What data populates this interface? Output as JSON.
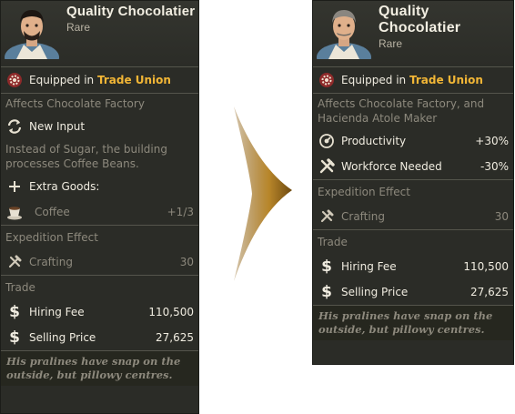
{
  "left_card": {
    "name": "Quality Chocolatier",
    "rarity": "Rare",
    "equipped_prefix": "Equipped in",
    "equipped_building": "Trade Union",
    "affects": "Affects Chocolate Factory",
    "effect_label": "New Input",
    "effect_desc": "Instead of Sugar, the building processes Coffee Beans.",
    "extra_goods_label": "Extra Goods:",
    "extra_goods_item": "Coffee",
    "extra_goods_value": "+1/3",
    "expedition_title": "Expedition Effect",
    "expedition_label": "Crafting",
    "expedition_value": "30",
    "trade_title": "Trade",
    "hiring_fee_label": "Hiring Fee",
    "hiring_fee_value": "110,500",
    "selling_price_label": "Selling Price",
    "selling_price_value": "27,625",
    "flavor": "His pralines have snap on the outside, but pillowy centres."
  },
  "right_card": {
    "name": "Quality Chocolatier",
    "rarity": "Rare",
    "equipped_prefix": "Equipped in",
    "equipped_building": "Trade Union",
    "affects": "Affects Chocolate Factory, and Hacienda Atole Maker",
    "productivity_label": "Productivity",
    "productivity_value": "+30%",
    "workforce_label": "Workforce Needed",
    "workforce_value": "-30%",
    "expedition_title": "Expedition Effect",
    "expedition_label": "Crafting",
    "expedition_value": "30",
    "trade_title": "Trade",
    "hiring_fee_label": "Hiring Fee",
    "hiring_fee_value": "110,500",
    "selling_price_label": "Selling Price",
    "selling_price_value": "27,625",
    "flavor": "His pralines have snap on the outside, but pillowy centres."
  },
  "colors": {
    "panel_bg": "#2b2c27",
    "gold_highlight": "#f2b636",
    "muted_text": "#8d897d",
    "arrow": "#b8862a"
  },
  "icons": {
    "equipped": "gear-badge-icon",
    "new_input": "cycle-arrows-icon",
    "extra_goods": "plus-icon",
    "coffee": "coffee-cup-icon",
    "crafting": "hammer-wrench-icon",
    "money": "dollar-icon",
    "productivity": "gauge-icon",
    "workforce": "tools-icon",
    "transition": "chevron-arrow-icon"
  }
}
